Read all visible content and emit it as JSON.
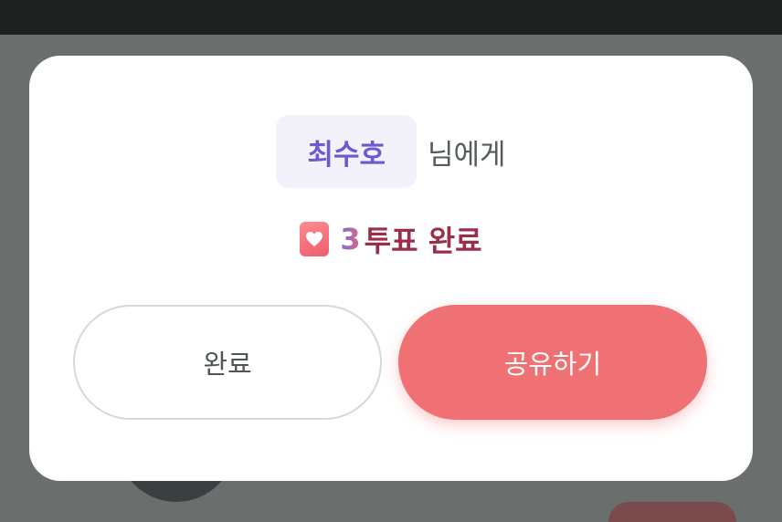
{
  "recipient": {
    "name": "최수호",
    "suffix": "님에게"
  },
  "vote": {
    "icon": "heart-icon",
    "count": "3",
    "label": "투표 완료"
  },
  "buttons": {
    "done_label": "완료",
    "share_label": "공유하기"
  },
  "colors": {
    "accent": "#f07174",
    "name": "#6c5bd0",
    "vote_text": "#9b2f4a"
  }
}
